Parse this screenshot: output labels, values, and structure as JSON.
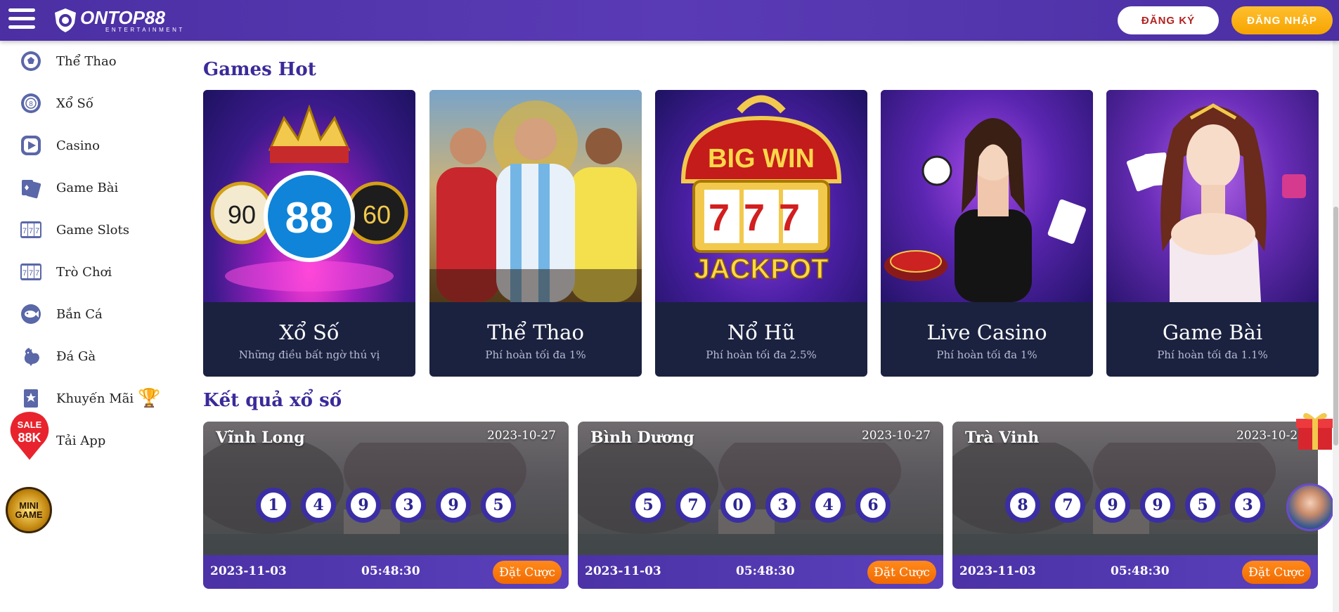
{
  "header": {
    "logo_text": "ONTOP88",
    "logo_subtext": "ENTERTAINMENT",
    "register_label": "ĐĂNG KÝ",
    "login_label": "ĐĂNG NHẬP"
  },
  "sidebar": {
    "items": [
      {
        "label": "Thể Thao",
        "icon": "soccer-ball-icon"
      },
      {
        "label": "Xổ Số",
        "icon": "lottery-ball-icon"
      },
      {
        "label": "Casino",
        "icon": "play-icon"
      },
      {
        "label": "Game Bài",
        "icon": "playing-cards-icon"
      },
      {
        "label": "Game Slots",
        "icon": "slot-777-icon"
      },
      {
        "label": "Trò Chơi",
        "icon": "slot-777-icon"
      },
      {
        "label": "Bắn Cá",
        "icon": "fish-icon"
      },
      {
        "label": "Đá Gà",
        "icon": "rooster-icon"
      },
      {
        "label": "Khuyến Mãi",
        "icon": "promotion-badge-icon"
      },
      {
        "label": "Tải App",
        "icon": "download-icon"
      }
    ],
    "sale_badge": {
      "line1": "SALE",
      "line2": "88K"
    },
    "mini_game": {
      "line1": "MINI",
      "line2": "GAME"
    }
  },
  "games_hot": {
    "title": "Games Hot",
    "cards": [
      {
        "name": "Xổ Số",
        "desc": "Những điều bất ngờ thú vị",
        "art_text": "88"
      },
      {
        "name": "Thể Thao",
        "desc": "Phí hoàn tối đa 1%"
      },
      {
        "name": "Nổ Hũ",
        "desc": "Phí hoàn tối đa 2.5%",
        "art_text": "BIG WIN",
        "art_text2": "JACKPOT",
        "art_text3": "777"
      },
      {
        "name": "Live Casino",
        "desc": "Phí hoàn tối đa 1%"
      },
      {
        "name": "Game Bài",
        "desc": "Phí hoàn tối đa 1.1%"
      }
    ]
  },
  "lottery": {
    "title": "Kết quả xổ số",
    "cards": [
      {
        "name": "Vĩnh Long",
        "date": "2023-10-27",
        "numbers": [
          "1",
          "4",
          "9",
          "3",
          "9",
          "5"
        ],
        "next_date": "2023-11-03",
        "countdown": "05:48:30",
        "bet_label": "Đặt Cược"
      },
      {
        "name": "Bình Dương",
        "date": "2023-10-27",
        "numbers": [
          "5",
          "7",
          "0",
          "3",
          "4",
          "6"
        ],
        "next_date": "2023-11-03",
        "countdown": "05:48:30",
        "bet_label": "Đặt Cược"
      },
      {
        "name": "Trà Vinh",
        "date": "2023-10-27",
        "numbers": [
          "8",
          "7",
          "9",
          "9",
          "5",
          "3"
        ],
        "next_date": "2023-11-03",
        "countdown": "05:48:30",
        "bet_label": "Đặt Cược"
      }
    ]
  },
  "colors": {
    "header": "#4b2fa3",
    "accent_gold": "#f6a400",
    "title": "#3a2a99",
    "card_bg": "#1b2240",
    "bet_button": "#f16a00"
  }
}
